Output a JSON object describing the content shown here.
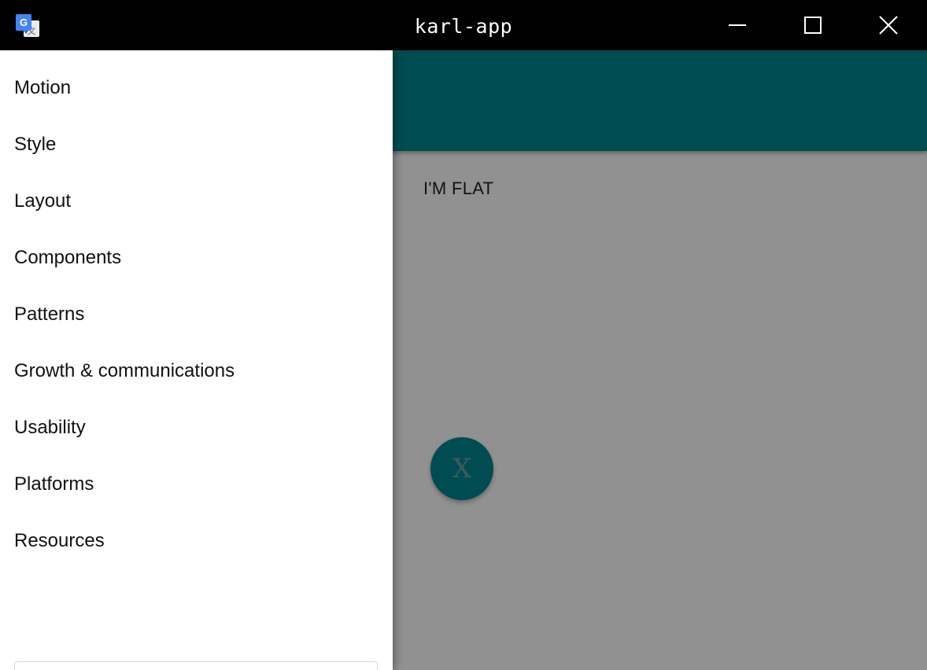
{
  "window": {
    "title": "karl-app",
    "app_icon": "google-translate-icon",
    "controls": {
      "minimize_icon": "minimize-icon",
      "maximize_icon": "maximize-icon",
      "close_icon": "close-icon"
    }
  },
  "colors": {
    "titlebar": "#000000",
    "primary": "#00838f",
    "drawer_bg": "#ffffff",
    "scrim": "rgba(0,0,0,0.42)"
  },
  "main": {
    "flat_button_label": "I'M FLAT",
    "fab_label": "X"
  },
  "drawer": {
    "items": [
      {
        "label": "Motion"
      },
      {
        "label": "Style"
      },
      {
        "label": "Layout"
      },
      {
        "label": "Components"
      },
      {
        "label": "Patterns"
      },
      {
        "label": "Growth & communications"
      },
      {
        "label": "Usability"
      },
      {
        "label": "Platforms"
      },
      {
        "label": "Resources"
      }
    ]
  }
}
